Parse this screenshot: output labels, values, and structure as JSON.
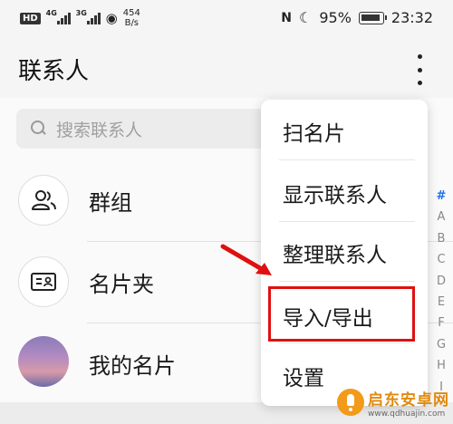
{
  "status_bar": {
    "hd_label": "HD",
    "sim1_label": "4G",
    "sim2_label": "3G",
    "wifi_icon": "wifi-icon",
    "speed_value": "454",
    "speed_unit": "B/s",
    "nfc_label": "N",
    "battery_percent": "95%",
    "time": "23:32"
  },
  "header": {
    "title": "联系人",
    "more_icon": "more-vertical-icon"
  },
  "search": {
    "placeholder": "搜索联系人"
  },
  "list": [
    {
      "label": "群组",
      "icon": "group-icon"
    },
    {
      "label": "名片夹",
      "icon": "card-holder-icon"
    },
    {
      "label": "我的名片",
      "icon": "avatar"
    }
  ],
  "alpha_index": [
    "#",
    "A",
    "B",
    "C",
    "D",
    "E",
    "F",
    "G",
    "H",
    "I"
  ],
  "popup_menu": {
    "items": [
      "扫名片",
      "显示联系人",
      "整理联系人",
      "导入/导出",
      "设置"
    ],
    "highlighted": "导入/导出",
    "highlight_color": "#e01010"
  },
  "watermark": {
    "title": "启东安卓网",
    "url": "www.qdhuajin.com"
  }
}
